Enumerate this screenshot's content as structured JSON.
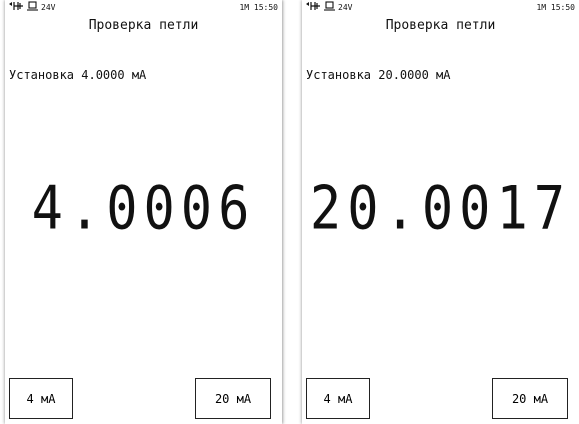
{
  "screens": [
    {
      "status": {
        "voltage": "24V",
        "right": "1M 15:50"
      },
      "title": "Проверка петли",
      "setpoint": "Установка 4.0000 мА",
      "reading": "4.0006",
      "buttons": {
        "low": "4 мА",
        "high": "20 мА"
      }
    },
    {
      "status": {
        "voltage": "24V",
        "right": "1M 15:50"
      },
      "title": "Проверка петли",
      "setpoint": "Установка 20.0000 мА",
      "reading": "20.0017",
      "buttons": {
        "low": "4 мА",
        "high": "20 мА"
      }
    }
  ],
  "icons": [
    "loop-power-icon",
    "source-icon"
  ]
}
